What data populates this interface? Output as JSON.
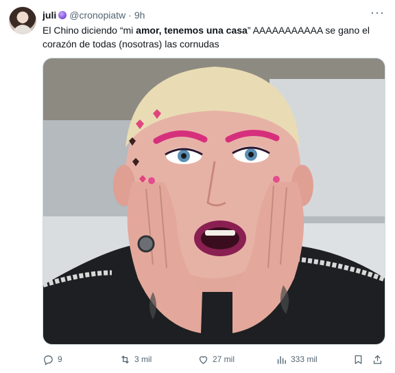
{
  "tweet": {
    "display_name": "juli",
    "handle": "@cronopiatw",
    "separator": "·",
    "time": "9h",
    "more_label": "···",
    "text_part1": "El Chino diciendo “mi ",
    "text_bold": "amor, tenemos una casa",
    "text_part2": "” AAAAAAAAAAA se gano el corazón de todas (nosotras) las cornudas"
  },
  "actions": {
    "reply_count": "9",
    "retweet_count": "3 mil",
    "like_count": "27 mil",
    "views_count": "333 mil"
  },
  "icons": {
    "reply": "reply-icon",
    "retweet": "retweet-icon",
    "like": "heart-icon",
    "views": "views-icon",
    "bookmark": "bookmark-icon",
    "share": "share-icon",
    "badge": "verified-badge-icon",
    "more": "more-icon"
  },
  "colors": {
    "text": "#0f1419",
    "secondary": "#536471",
    "border": "#cfd9de",
    "badge": "#7b4fd6"
  }
}
